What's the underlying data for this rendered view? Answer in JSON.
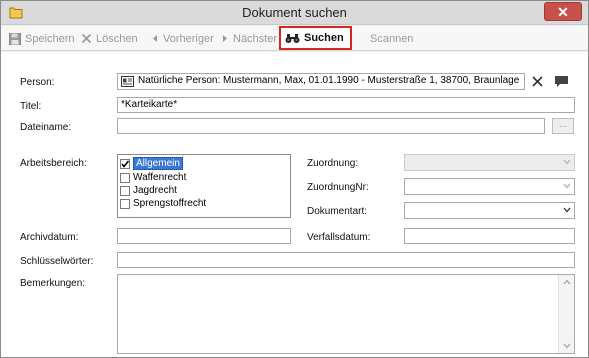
{
  "window": {
    "title": "Dokument suchen",
    "close_glyph": "✕"
  },
  "toolbar": {
    "items": [
      {
        "label": "Speichern",
        "icon": "save-icon",
        "enabled": false
      },
      {
        "label": "Löschen",
        "icon": "delete-icon",
        "enabled": false
      },
      {
        "label": "Vorheriger",
        "icon": "previous-icon",
        "enabled": false
      },
      {
        "label": "Nächster",
        "icon": "next-icon",
        "enabled": false
      },
      {
        "label": "Suchen",
        "icon": "binoculars-icon",
        "enabled": true,
        "highlighted": true
      },
      {
        "label": "Scannen",
        "icon": "",
        "enabled": false
      }
    ]
  },
  "form": {
    "person": {
      "label": "Person:",
      "value": "Natürliche Person: Mustermann, Max, 01.01.1990 - Musterstraße 1, 38700, Braunlage"
    },
    "titel": {
      "label": "Titel:",
      "value": "*Karteikarte*"
    },
    "dateiname": {
      "label": "Dateiname:",
      "value": "",
      "browse_label": "..."
    },
    "arbeitsbereich": {
      "label": "Arbeitsbereich:",
      "options": [
        {
          "label": "Allgemein",
          "checked": true,
          "selected": true
        },
        {
          "label": "Waffenrecht",
          "checked": false,
          "selected": false
        },
        {
          "label": "Jagdrecht",
          "checked": false,
          "selected": false
        },
        {
          "label": "Sprengstoffrecht",
          "checked": false,
          "selected": false
        }
      ]
    },
    "zuordnung": {
      "label": "Zuordnung:",
      "value": ""
    },
    "zuordnung_nr": {
      "label": "ZuordnungNr:",
      "value": ""
    },
    "dokumentart": {
      "label": "Dokumentart:",
      "value": ""
    },
    "archivdatum": {
      "label": "Archivdatum:",
      "value": ""
    },
    "verfallsdatum": {
      "label": "Verfallsdatum:",
      "value": ""
    },
    "schluesselwoerter": {
      "label": "Schlüsselwörter:",
      "value": ""
    },
    "bemerkungen": {
      "label": "Bemerkungen:",
      "value": ""
    }
  },
  "colors": {
    "highlight_border": "#d8231f",
    "selection": "#3a78d8",
    "close": "#c7504a"
  }
}
